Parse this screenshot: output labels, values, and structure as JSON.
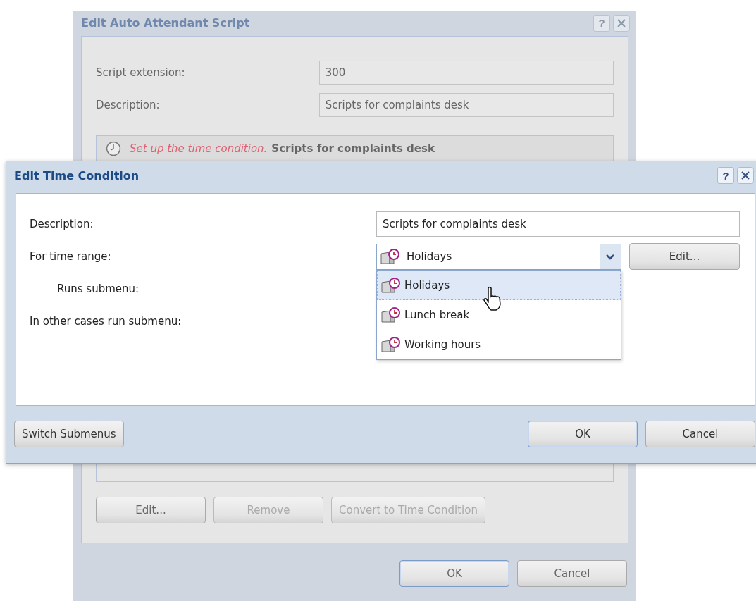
{
  "script_dialog": {
    "title": "Edit Auto Attendant Script",
    "help": "?",
    "fields": [
      {
        "label": "Script extension:",
        "value": "300",
        "disabled": true
      },
      {
        "label": "Description:",
        "value": "Scripts for complaints desk",
        "disabled": true
      }
    ],
    "list_items": [
      {
        "note": "Set up the time condition.",
        "text": "Scripts for complaints desk"
      }
    ],
    "buttons": [
      {
        "label": "Edit...",
        "disabled": false
      },
      {
        "label": "Remove",
        "disabled": true
      },
      {
        "label": "Convert to Time Condition",
        "disabled": true
      }
    ],
    "footer_buttons": [
      {
        "label": "OK",
        "default": true
      },
      {
        "label": "Cancel",
        "default": false
      }
    ]
  },
  "time_condition_dialog": {
    "title": "Edit Time Condition",
    "help": "?",
    "description": {
      "label": "Description:",
      "value": "Scripts for complaints desk"
    },
    "time_range": {
      "label": "For time range:",
      "value": "Holidays",
      "edit_button": "Edit...",
      "options": [
        {
          "label": "Holidays",
          "selected": true
        },
        {
          "label": "Lunch break",
          "selected": false
        },
        {
          "label": "Working hours",
          "selected": false
        }
      ]
    },
    "labels": [
      {
        "text": "Runs submenu:",
        "indented": true
      },
      {
        "text": "In other cases run submenu:",
        "indented": false
      }
    ],
    "left_buttons": [
      {
        "label": "Switch Submenus",
        "default": false
      }
    ],
    "right_buttons": [
      {
        "label": "OK",
        "default": true
      },
      {
        "label": "Cancel",
        "default": false
      }
    ]
  }
}
